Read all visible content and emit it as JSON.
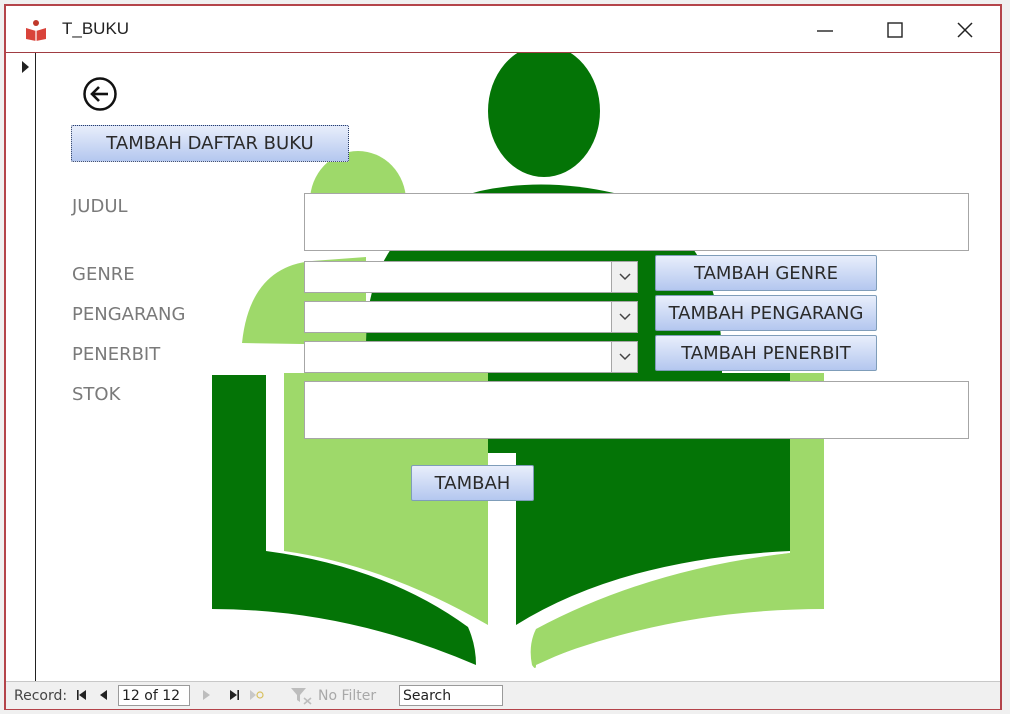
{
  "window": {
    "title": "T_BUKU"
  },
  "form": {
    "header_button": "TAMBAH DAFTAR BUKU",
    "fields": {
      "judul": {
        "label": "JUDUL",
        "value": ""
      },
      "genre": {
        "label": "GENRE",
        "value": ""
      },
      "pengarang": {
        "label": "PENGARANG",
        "value": ""
      },
      "penerbit": {
        "label": "PENERBIT",
        "value": ""
      },
      "stok": {
        "label": "STOK",
        "value": ""
      }
    },
    "buttons": {
      "tambah_genre": "TAMBAH GENRE",
      "tambah_pengarang": "TAMBAH PENGARANG",
      "tambah_penerbit": "TAMBAH PENERBIT",
      "tambah": "TAMBAH"
    }
  },
  "navigation": {
    "record_label": "Record:",
    "record_position": "12 of 12",
    "filter_label": "No Filter",
    "search_placeholder": "Search"
  },
  "colors": {
    "dark_green": "#047406",
    "light_green": "#9ed96a",
    "border": "#b4444a",
    "button": "#c6d4f2"
  }
}
